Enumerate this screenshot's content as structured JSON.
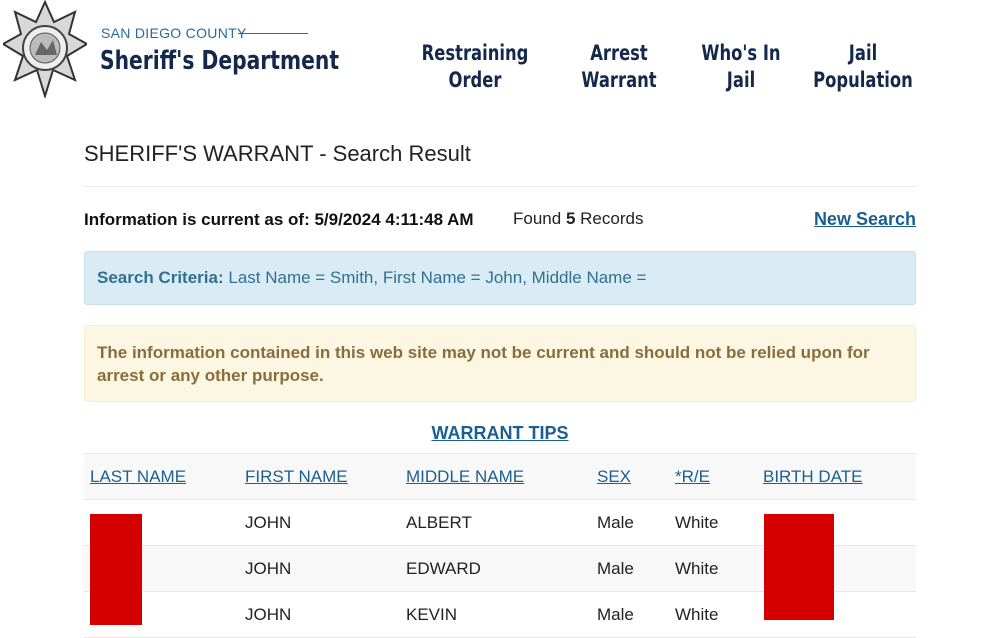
{
  "header": {
    "brand_top": "SAN DIEGO COUNTY",
    "brand_main": "Sheriff's Department",
    "logo_icon": "sheriff-star-badge-icon",
    "nav": [
      {
        "line1": "Restraining",
        "line2": "Order"
      },
      {
        "line1": "Arrest",
        "line2": "Warrant"
      },
      {
        "line1": "Who's In",
        "line2": "Jail"
      },
      {
        "line1": "Jail",
        "line2": "Population"
      }
    ]
  },
  "page": {
    "title": "SHERIFF'S WARRANT - Search Result",
    "info_current": "Information is current as of: 5/9/2024 4:11:48 AM",
    "found_prefix": "Found",
    "found_count": "5",
    "found_suffix": "Records",
    "new_search": "New Search"
  },
  "criteria": {
    "label": "Search Criteria:",
    "text": "Last Name = Smith, First Name = John, Middle Name ="
  },
  "warning": "The information contained in this web site may not be current and should not be relied upon for arrest or any other purpose.",
  "warrant_tips": "WARRANT TIPS",
  "table": {
    "headers": [
      "LAST NAME",
      "FIRST NAME",
      "MIDDLE NAME",
      "SEX",
      "*R/E",
      "BIRTH DATE"
    ],
    "rows": [
      {
        "last": "[redacted]",
        "first": "JOHN",
        "middle": "ALBERT",
        "sex": "Male",
        "re": "White",
        "birth": "[redacted]"
      },
      {
        "last": "[redacted]",
        "first": "JOHN",
        "middle": "EDWARD",
        "sex": "Male",
        "re": "White",
        "birth": "[redacted]"
      },
      {
        "last": "[redacted]",
        "first": "JOHN",
        "middle": "KEVIN",
        "sex": "Male",
        "re": "White",
        "birth": "[redacted]"
      }
    ]
  },
  "colors": {
    "brand_navy": "#14284b",
    "link_blue": "#1a5f8f",
    "info_bg": "#d9ecf6",
    "warning_bg": "#fcf7e3",
    "redaction": "#d40000"
  }
}
